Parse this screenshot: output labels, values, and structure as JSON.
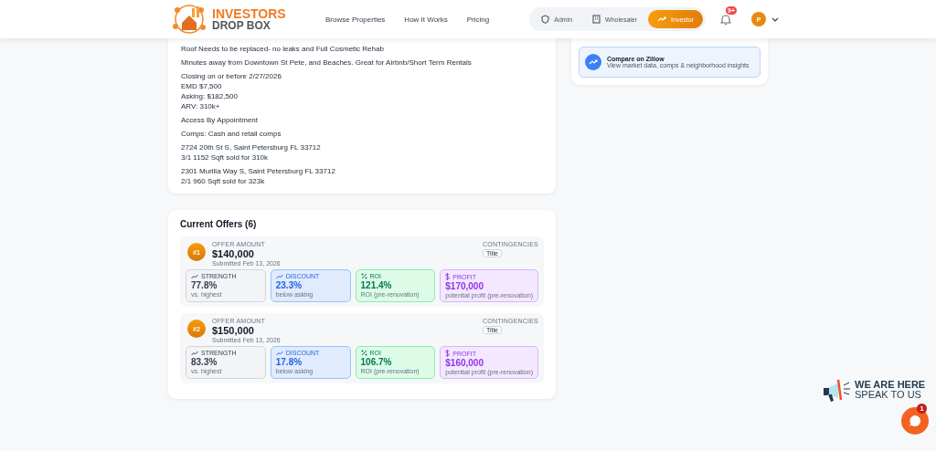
{
  "header": {
    "logo": {
      "line1": "INVESTORS",
      "line2": "DROP BOX"
    },
    "nav": [
      {
        "label": "Browse Properties"
      },
      {
        "label": "How It Works"
      },
      {
        "label": "Pricing"
      }
    ],
    "roles": [
      {
        "label": "Admin",
        "selected": false
      },
      {
        "label": "Wholesaler",
        "selected": false
      },
      {
        "label": "Investor",
        "selected": true
      }
    ],
    "notifications": {
      "badge": "9+"
    },
    "avatar": {
      "initial": "P"
    }
  },
  "description": {
    "paragraphs": [
      [
        "Roof Needs to be replaced- no leaks and Full Cosmetic Rehab"
      ],
      [
        "Minutes away from Downtown St Pete, and Beaches. Great for Airbnb/Short Term Rentals"
      ],
      [
        "Closing on or before 2/27/2026",
        "EMD $7,500",
        "Asking: $182,500",
        "ARV: 310k+"
      ],
      [
        "Access By Appointment"
      ],
      [
        "Comps: Cash and retail comps"
      ],
      [
        "2724 20th St S, Saint Petersburg FL 33712",
        "3/1 1152 Sqft sold for 310k"
      ],
      [
        "2301 Murilla Way S, Saint Petersburg FL 33712",
        "2/1 960 Sqft sold for 323k"
      ]
    ]
  },
  "zillow": {
    "title": "Compare on Zillow",
    "subtitle": "View market data, comps & neighborhood insights"
  },
  "offers": {
    "title": "Current Offers (6)",
    "items": [
      {
        "rank": "#1",
        "amount_label": "OFFER AMOUNT",
        "amount": "$140,000",
        "submitted": "Submitted Feb 13, 2026",
        "contingencies_label": "CONTINGENCIES",
        "contingencies": [
          "Title"
        ],
        "metrics": [
          {
            "kind": "strength",
            "label": "STRENGTH",
            "value": "77.8%",
            "note": "vs. highest"
          },
          {
            "kind": "discount",
            "label": "DISCOUNT",
            "value": "23.3%",
            "note": "below asking"
          },
          {
            "kind": "roi",
            "label": "ROI",
            "value": "121.4%",
            "note": "ROI (pre-renovation)"
          },
          {
            "kind": "profit",
            "label": "PROFIT",
            "value": "$170,000",
            "note": "potential profit (pre-renovation)"
          }
        ]
      },
      {
        "rank": "#2",
        "amount_label": "OFFER AMOUNT",
        "amount": "$150,000",
        "submitted": "Submitted Feb 13, 2026",
        "contingencies_label": "CONTINGENCIES",
        "contingencies": [
          "Title"
        ],
        "metrics": [
          {
            "kind": "strength",
            "label": "STRENGTH",
            "value": "83.3%",
            "note": "vs. highest"
          },
          {
            "kind": "discount",
            "label": "DISCOUNT",
            "value": "17.8%",
            "note": "below asking"
          },
          {
            "kind": "roi",
            "label": "ROI",
            "value": "106.7%",
            "note": "ROI (pre-renovation)"
          },
          {
            "kind": "profit",
            "label": "PROFIT",
            "value": "$160,000",
            "note": "potential profit (pre-renovation)"
          }
        ]
      }
    ]
  },
  "chat": {
    "line1": "WE ARE HERE",
    "line2": "SPEAK TO US",
    "badge": "1"
  }
}
